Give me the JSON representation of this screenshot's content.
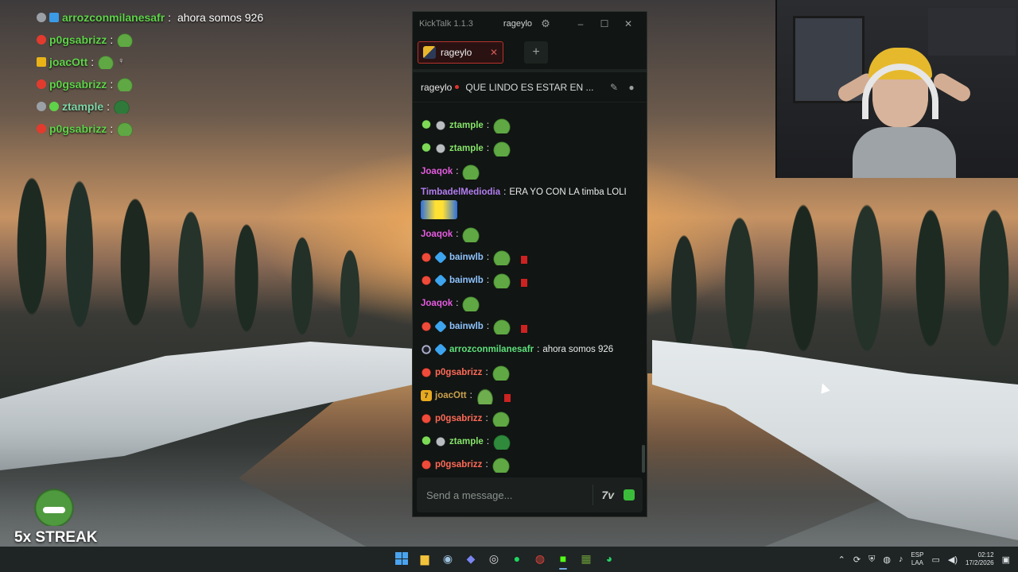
{
  "overlay_chat": [
    {
      "name": "arrozconmilanesafr",
      "message": "ahora somos 926",
      "name_color": "#5fd34a"
    },
    {
      "name": "p0gsabrizz",
      "message": "",
      "name_color": "#5fd34a"
    },
    {
      "name": "joacOtt",
      "message": "",
      "name_color": "#5fd34a"
    },
    {
      "name": "p0gsabrizz",
      "message": "",
      "name_color": "#5fd34a"
    },
    {
      "name": "ztample",
      "message": "",
      "name_color": "#7fd6a8"
    },
    {
      "name": "p0gsabrizz",
      "message": "",
      "name_color": "#5fd34a"
    }
  ],
  "streak": {
    "label": "5x STREAK"
  },
  "kicktalk": {
    "app_title": "KickTalk 1.1.3",
    "current_user": "rageylo",
    "tab": {
      "label": "rageylo"
    },
    "channel": {
      "name": "rageylo",
      "stream_title": "QUE LINDO ES ESTAR EN ..."
    },
    "input": {
      "placeholder": "Send a message..."
    },
    "emote_picker_label": "7v",
    "messages": [
      {
        "badges": [
          "alien",
          "grey"
        ],
        "user": "ztample",
        "color": "c-green",
        "text": "",
        "emotes": [
          "pepe"
        ]
      },
      {
        "badges": [
          "alien",
          "grey"
        ],
        "user": "ztample",
        "color": "c-green",
        "text": "",
        "emotes": [
          "pepe"
        ]
      },
      {
        "badges": [],
        "user": "Joaqok",
        "color": "c-pink",
        "text": "",
        "emotes": [
          "pepe"
        ]
      },
      {
        "badges": [],
        "user": "TimbadelMediodia",
        "color": "c-purple",
        "text": "ERA YO CON LA timba LOLI",
        "emotes": [
          "yellow"
        ],
        "tall": true
      },
      {
        "badges": [],
        "user": "Joaqok",
        "color": "c-pink",
        "text": "",
        "emotes": [
          "pepe"
        ]
      },
      {
        "badges": [
          "red",
          "cube"
        ],
        "user": "bainwlb",
        "color": "c-blue",
        "text": "",
        "emotes": [
          "pepe",
          "bag"
        ]
      },
      {
        "badges": [
          "red",
          "cube"
        ],
        "user": "bainwlb",
        "color": "c-blue",
        "text": "",
        "emotes": [
          "pepe",
          "bag"
        ]
      },
      {
        "badges": [],
        "user": "Joaqok",
        "color": "c-pink",
        "text": "",
        "emotes": [
          "pepe"
        ]
      },
      {
        "badges": [
          "red",
          "cube"
        ],
        "user": "bainwlb",
        "color": "c-blue",
        "text": "",
        "emotes": [
          "pepe",
          "bag"
        ]
      },
      {
        "badges": [
          "ring",
          "cube"
        ],
        "user": "arrozconmilanesafr",
        "color": "c-teal",
        "text": "ahora somos 926",
        "emotes": []
      },
      {
        "badges": [
          "red"
        ],
        "user": "p0gsabrizz",
        "color": "c-red",
        "text": "",
        "emotes": [
          "pepe"
        ]
      },
      {
        "badges": [
          "seven"
        ],
        "user": "joacOtt",
        "color": "c-gold",
        "text": "",
        "emotes": [
          "pile",
          "bag"
        ]
      },
      {
        "badges": [
          "red"
        ],
        "user": "p0gsabrizz",
        "color": "c-red",
        "text": "",
        "emotes": [
          "pepe"
        ]
      },
      {
        "badges": [
          "alien",
          "grey"
        ],
        "user": "ztample",
        "color": "c-green",
        "text": "",
        "emotes": [
          "dark"
        ]
      },
      {
        "badges": [
          "red"
        ],
        "user": "p0gsabrizz",
        "color": "c-red",
        "text": "",
        "emotes": [
          "pepe"
        ]
      }
    ]
  },
  "taskbar": {
    "apps": [
      "start",
      "file-explorer",
      "steam",
      "discord",
      "obs",
      "spotify",
      "chrome",
      "kick",
      "minecraft",
      "whatsapp"
    ],
    "language": [
      "ESP",
      "LAA"
    ],
    "time": "02:12",
    "date": "17/2/2026"
  }
}
